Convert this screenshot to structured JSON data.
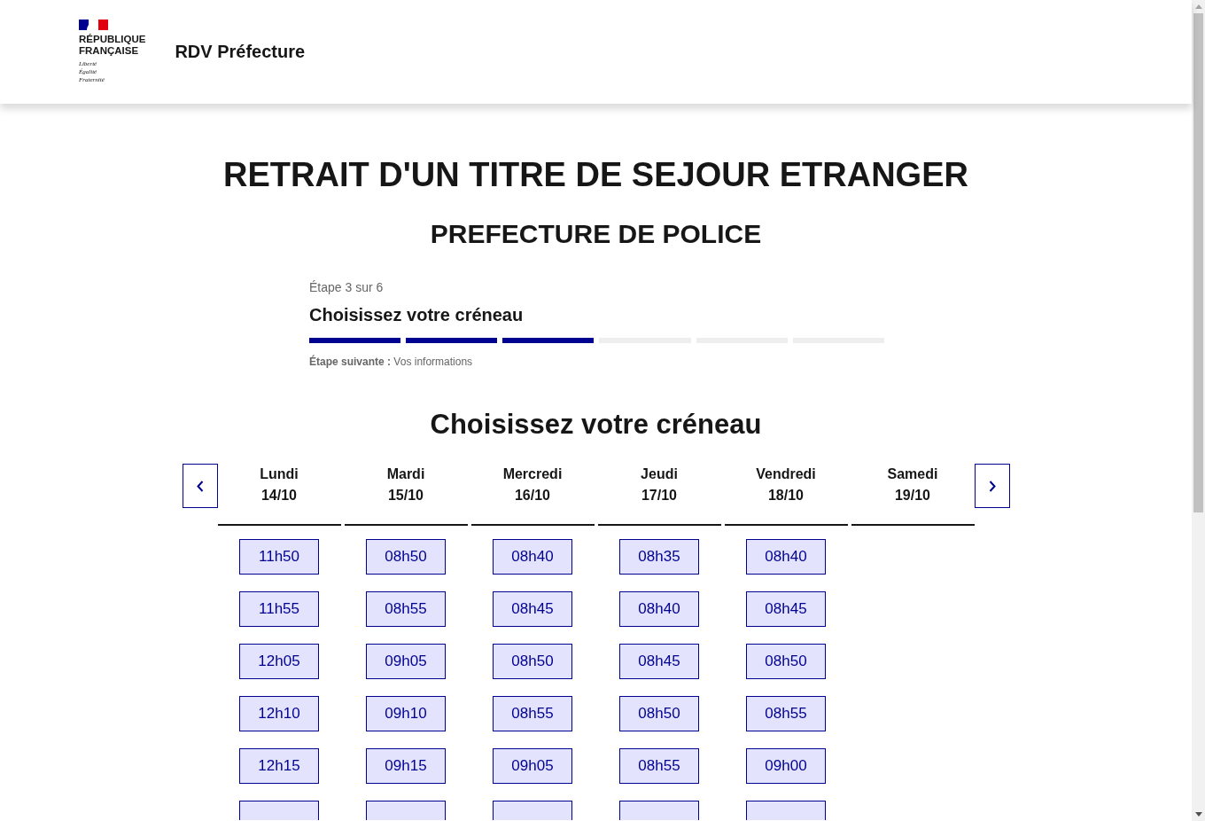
{
  "header": {
    "logo": {
      "wordmark": [
        "RÉPUBLIQUE",
        "FRANÇAISE"
      ],
      "motto": [
        "Liberté",
        "Égalité",
        "Fraternité"
      ]
    },
    "service_name": "RDV Préfecture"
  },
  "title": "RETRAIT D'UN TITRE DE SEJOUR ETRANGER",
  "subtitle": "PREFECTURE DE POLICE",
  "stepper": {
    "step_label": "Étape 3 sur 6",
    "step_title": "Choisissez votre créneau",
    "steps": [
      {
        "completed": true
      },
      {
        "completed": true
      },
      {
        "completed": true
      },
      {
        "completed": false
      },
      {
        "completed": false
      },
      {
        "completed": false
      }
    ],
    "next_step": "**Étape suivante :** Vos informations"
  },
  "slot_picker": {
    "heading": "Choisissez votre créneau",
    "days": [
      {
        "name": "Lundi",
        "date": "14/10",
        "slots": [
          "11h50",
          "11h55",
          "12h05",
          "12h10",
          "12h15"
        ],
        "clipped_below": true
      },
      {
        "name": "Mardi",
        "date": "15/10",
        "slots": [
          "08h50",
          "08h55",
          "09h05",
          "09h10",
          "09h15"
        ],
        "clipped_below": true
      },
      {
        "name": "Mercredi",
        "date": "16/10",
        "slots": [
          "08h40",
          "08h45",
          "08h50",
          "08h55",
          "09h05"
        ],
        "clipped_below": true
      },
      {
        "name": "Jeudi",
        "date": "17/10",
        "slots": [
          "08h35",
          "08h40",
          "08h45",
          "08h50",
          "08h55"
        ],
        "clipped_below": true
      },
      {
        "name": "Vendredi",
        "date": "18/10",
        "slots": [
          "08h40",
          "08h45",
          "08h50",
          "08h55",
          "09h00"
        ],
        "clipped_below": true
      },
      {
        "name": "Samedi",
        "date": "19/10",
        "clipped_below": false
      }
    ]
  }
}
